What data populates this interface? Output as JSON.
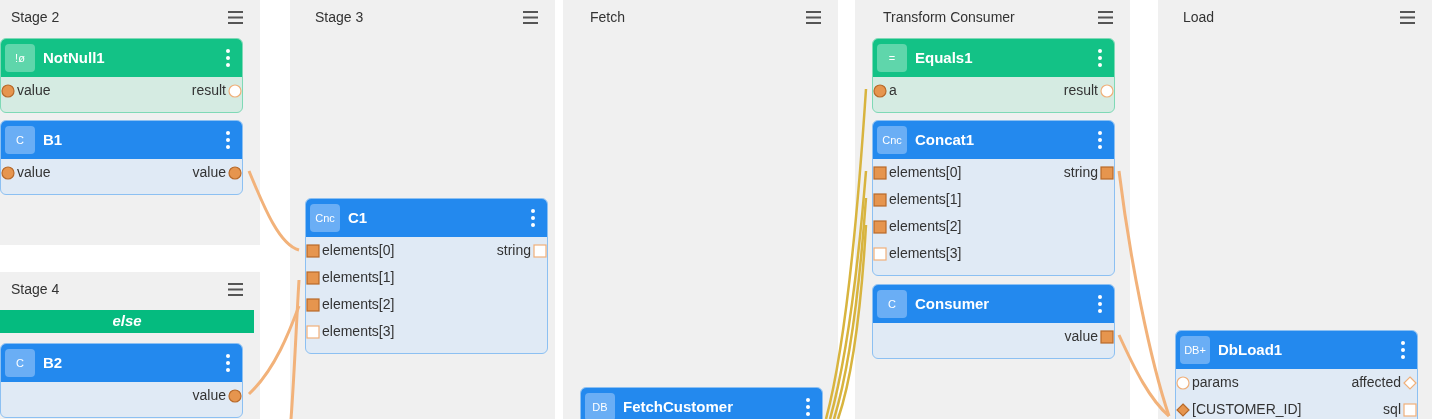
{
  "lanes": [
    {
      "title": "Stage 2",
      "nodes": [
        {
          "kind": "logic",
          "badge": "!ø",
          "title": "NotNull1",
          "rows": [
            {
              "in": {
                "label": "value",
                "kind": "circle",
                "connected": true
              },
              "out": {
                "label": "result",
                "kind": "circle",
                "connected": false
              }
            }
          ]
        },
        {
          "kind": "component",
          "badge": "C",
          "title": "B1",
          "rows": [
            {
              "in": {
                "label": "value",
                "kind": "circle",
                "connected": true
              },
              "out": {
                "label": "value",
                "kind": "circle",
                "connected": true
              }
            }
          ]
        }
      ]
    },
    {
      "title": "Stage 4",
      "banner": "else",
      "nodes": [
        {
          "kind": "component",
          "badge": "C",
          "title": "B2",
          "rows": [
            {
              "out": {
                "label": "value",
                "kind": "circle",
                "connected": true
              }
            }
          ]
        }
      ]
    },
    {
      "title": "Stage 3",
      "nodes": [
        {
          "kind": "component",
          "badge": "Cnc",
          "title": "C1",
          "rows": [
            {
              "in": {
                "label": "elements[0]",
                "kind": "square",
                "connected": true
              },
              "out": {
                "label": "string",
                "kind": "square",
                "connected": false
              }
            },
            {
              "in": {
                "label": "elements[1]",
                "kind": "square",
                "connected": true
              }
            },
            {
              "in": {
                "label": "elements[2]",
                "kind": "square",
                "connected": true
              }
            },
            {
              "in": {
                "label": "elements[3]",
                "kind": "square",
                "connected": false
              }
            }
          ]
        }
      ]
    },
    {
      "title": "Fetch",
      "nodes": [
        {
          "kind": "component",
          "badge": "DB",
          "title": "FetchCustomer"
        }
      ]
    },
    {
      "title": "Transform Consumer",
      "nodes": [
        {
          "kind": "logic",
          "badge": "=",
          "title": "Equals1",
          "rows": [
            {
              "in": {
                "label": "a",
                "kind": "circle",
                "connected": true
              },
              "out": {
                "label": "result",
                "kind": "circle",
                "connected": false
              }
            }
          ]
        },
        {
          "kind": "component",
          "badge": "Cnc",
          "title": "Concat1",
          "rows": [
            {
              "in": {
                "label": "elements[0]",
                "kind": "square",
                "connected": true
              },
              "out": {
                "label": "string",
                "kind": "square",
                "connected": true
              }
            },
            {
              "in": {
                "label": "elements[1]",
                "kind": "square",
                "connected": true
              }
            },
            {
              "in": {
                "label": "elements[2]",
                "kind": "square",
                "connected": true
              }
            },
            {
              "in": {
                "label": "elements[3]",
                "kind": "square",
                "connected": false
              }
            }
          ]
        },
        {
          "kind": "component",
          "badge": "C",
          "title": "Consumer",
          "rows": [
            {
              "out": {
                "label": "value",
                "kind": "square",
                "connected": true
              }
            }
          ]
        }
      ]
    },
    {
      "title": "Load",
      "nodes": [
        {
          "kind": "component",
          "badge": "DB+",
          "title": "DbLoad1",
          "rows": [
            {
              "in": {
                "label": "params",
                "kind": "circle",
                "connected": false
              },
              "out": {
                "label": "affected",
                "kind": "diamond",
                "connected": false
              }
            },
            {
              "in": {
                "label": "[CUSTOMER_ID]",
                "kind": "diamond",
                "connected": true
              },
              "out": {
                "label": "sql",
                "kind": "square",
                "connected": false
              }
            }
          ]
        }
      ]
    }
  ]
}
